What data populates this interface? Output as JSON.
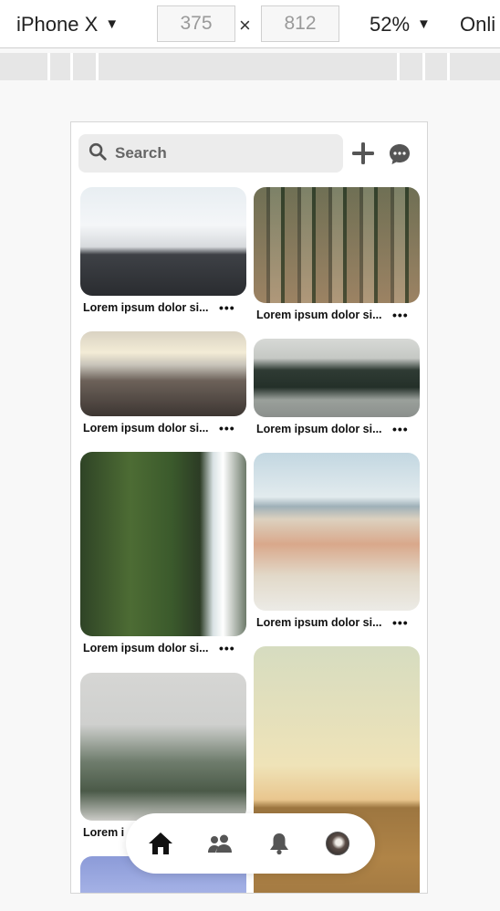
{
  "devtools": {
    "device": "iPhone X",
    "width": "375",
    "height": "812",
    "times": "×",
    "zoom": "52%",
    "network": "Onli",
    "caret": "▼"
  },
  "search": {
    "placeholder": "Search"
  },
  "pins": [
    {
      "caption": "Lorem ipsum dolor si...",
      "more": "•••",
      "image": "snowy-road"
    },
    {
      "caption": "Lorem ipsum dolor si...",
      "more": "•••",
      "image": "city-aerial"
    },
    {
      "caption": "Lorem ipsum dolor si...",
      "more": "•••",
      "image": "mountain-clouds"
    },
    {
      "caption": "Lorem ipsum dolor si...",
      "more": "•••",
      "image": "forest-road"
    },
    {
      "caption": "Lorem ipsum dolor si...",
      "more": "•••",
      "image": "waterfall"
    },
    {
      "caption": "Lorem ipsum dolor si...",
      "more": "•••",
      "image": "beach-sunbather"
    },
    {
      "caption": "Lorem i",
      "more": "",
      "image": "foggy-forest"
    },
    {
      "caption": "",
      "more": "",
      "image": "wheat-field"
    },
    {
      "caption": "",
      "more": "",
      "image": "blue-sky"
    }
  ],
  "nav": {
    "items": [
      "home-icon",
      "people-icon",
      "bell-icon",
      "avatar"
    ]
  },
  "colors": {
    "accent": "#111111",
    "search_bg": "#ececec",
    "icon_grey": "#555555"
  }
}
